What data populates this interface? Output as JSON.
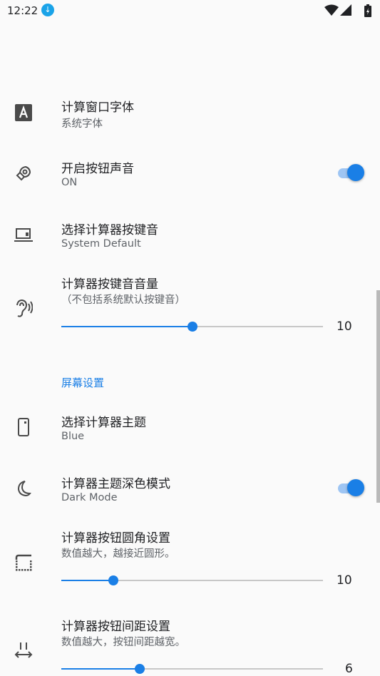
{
  "status_bar": {
    "time": "12:22"
  },
  "settings": {
    "font": {
      "title": "计算窗口字体",
      "subtitle": "系统字体",
      "icon": "font-letter-icon"
    },
    "button_sound": {
      "title": "开启按钮声音",
      "subtitle": "ON",
      "checked": true,
      "icon": "speaker-icon"
    },
    "key_tone": {
      "title": "选择计算器按键音",
      "subtitle": "System Default",
      "icon": "laptop-icon"
    },
    "key_volume": {
      "title": "计算器按键音音量",
      "subtitle": "（不包括系统默认按键音）",
      "value": "10",
      "fraction": 0.5,
      "icon": "hearing-icon"
    },
    "screen_section": {
      "label": "屏幕设置"
    },
    "theme": {
      "title": "选择计算器主题",
      "subtitle": "Blue",
      "icon": "phone-icon"
    },
    "dark_mode": {
      "title": "计算器主题深色模式",
      "subtitle": "Dark Mode",
      "checked": true,
      "icon": "moon-icon"
    },
    "corner_radius": {
      "title": "计算器按钮圆角设置",
      "subtitle": "数值越大，越接近圆形。",
      "value": "10",
      "fraction": 0.2,
      "icon": "rounded-corner-icon"
    },
    "button_spacing": {
      "title": "计算器按钮间距设置",
      "subtitle": "数值越大，按钮间距越宽。",
      "value": "6",
      "fraction": 0.3,
      "icon": "spacing-icon"
    }
  },
  "colors": {
    "accent": "#1a7fe6",
    "accent_light": "#9ec5f3",
    "background": "#fafafa"
  }
}
